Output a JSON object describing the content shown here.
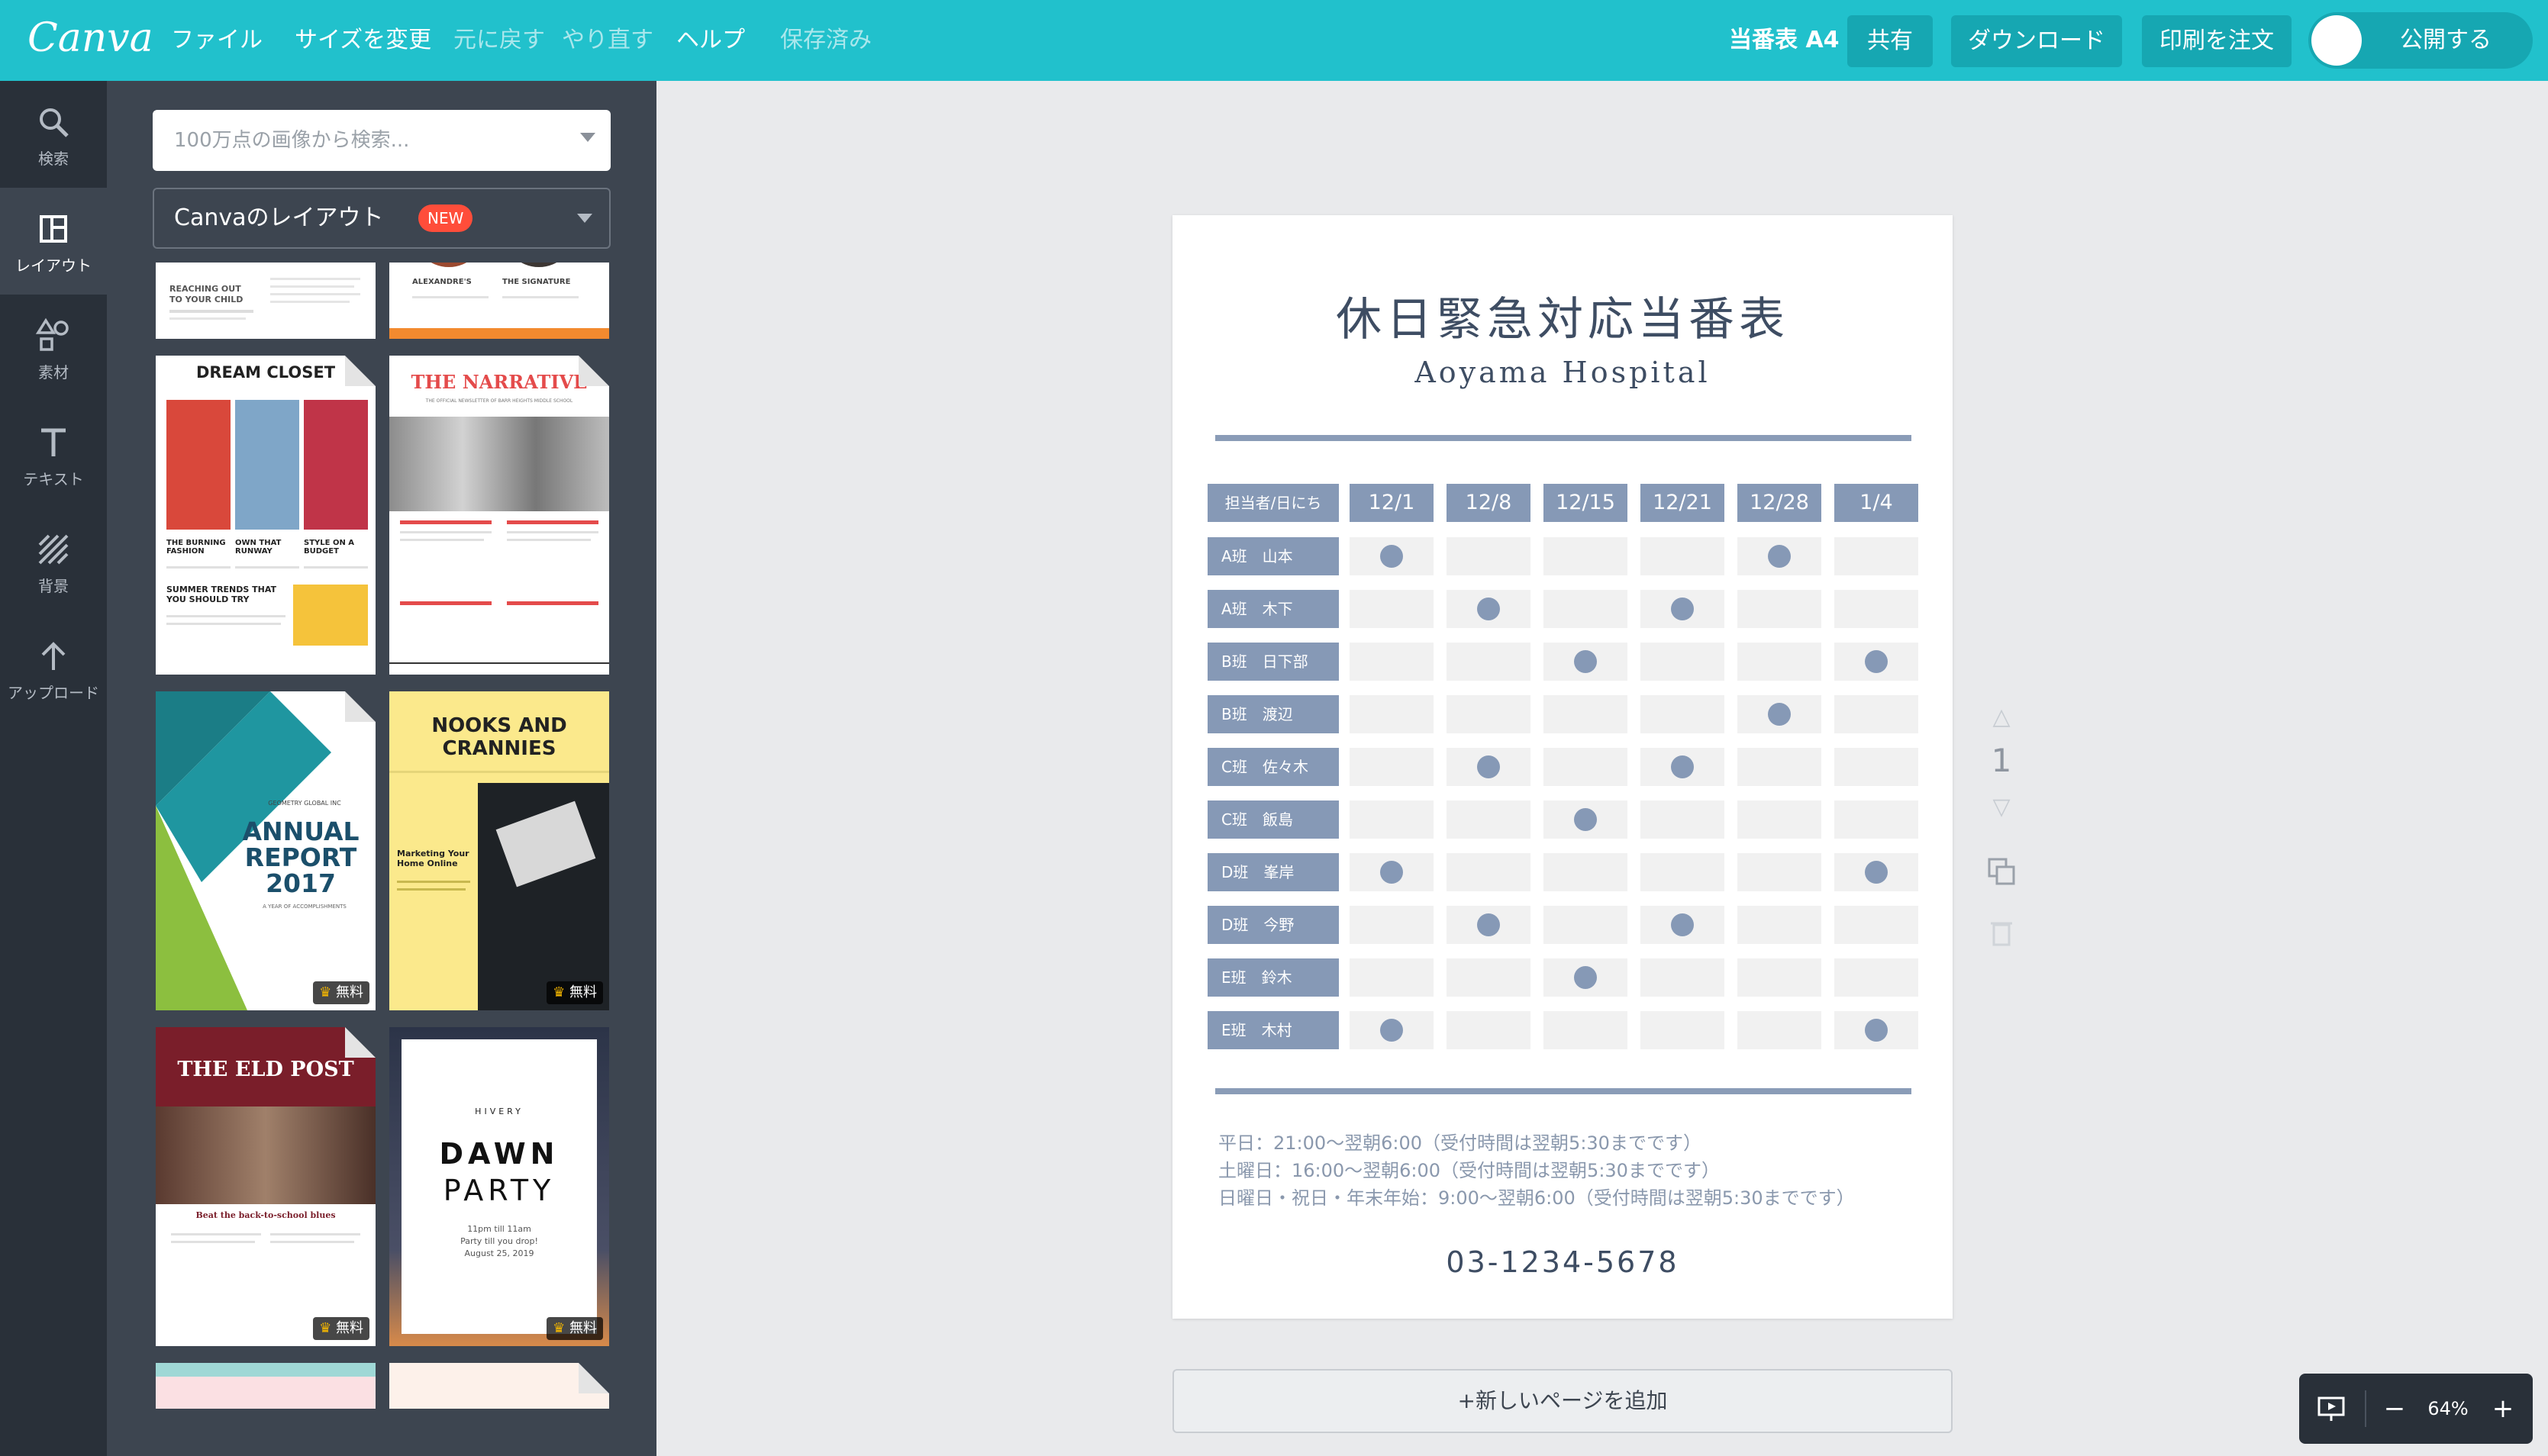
{
  "topbar": {
    "logo": "Canva",
    "menu": [
      "ファイル",
      "サイズを変更",
      "元に戻す",
      "やり直す",
      "ヘルプ",
      "保存済み"
    ],
    "doc_title": "当番表 A4",
    "share": "共有",
    "download": "ダウンロード",
    "order_print": "印刷を注文",
    "publish": "公開する",
    "accent_color": "#21c1cc"
  },
  "rail": [
    {
      "label": "検索",
      "icon": "search-icon"
    },
    {
      "label": "レイアウト",
      "icon": "layout-icon",
      "active": true
    },
    {
      "label": "素材",
      "icon": "elements-icon"
    },
    {
      "label": "テキスト",
      "icon": "text-icon"
    },
    {
      "label": "背景",
      "icon": "background-icon"
    },
    {
      "label": "アップロード",
      "icon": "upload-icon"
    }
  ],
  "panel": {
    "search_placeholder": "100万点の画像から検索...",
    "layout_select": "Canvaのレイアウト",
    "new_badge": "NEW",
    "free_label": "無料",
    "thumbs": {
      "t1": {
        "heading": "REACHING OUT TO YOUR CHILD"
      },
      "t2": {
        "heading_a": "ALEXANDRE'S",
        "heading_b": "THE SIGNATURE"
      },
      "t3": {
        "title": "DREAM CLOSET",
        "s1": "THE BURNING FASHION",
        "s2": "OWN THAT RUNWAY",
        "s3": "STYLE ON A BUDGET",
        "s4": "SUMMER TRENDS THAT YOU SHOULD TRY"
      },
      "t4": {
        "title": "THE NARRATIVE",
        "sub": "THE OFFICIAL NEWSLETTER OF BARR HEIGHTS MIDDLE SCHOOL"
      },
      "t5": {
        "org": "GEOMETRY GLOBAL INC",
        "title1": "ANNUAL",
        "title2": "REPORT",
        "year": "2017",
        "tag": "A YEAR OF ACCOMPLISHMENTS"
      },
      "t6": {
        "title": "NOOKS AND CRANNIES",
        "body": "Marketing Your Home Online"
      },
      "t7": {
        "title": "THE ELD POST",
        "sub": "Beat the back-to-school blues"
      },
      "t8": {
        "brand": "HIVERY",
        "title1": "DAWN",
        "title2": "PARTY",
        "line1": "11pm till 11am",
        "line2": "Party till you drop!",
        "date": "August 25, 2019"
      }
    }
  },
  "document": {
    "title": "休日緊急対応当番表",
    "subtitle": "Aoyama Hospital",
    "header_label": "担当者/日にち",
    "dates": [
      "12/1",
      "12/8",
      "12/15",
      "12/21",
      "12/28",
      "1/4"
    ],
    "rows": [
      {
        "name": "A班　山本",
        "duty": [
          true,
          false,
          false,
          false,
          true,
          false
        ]
      },
      {
        "name": "A班　木下",
        "duty": [
          false,
          true,
          false,
          true,
          false,
          false
        ]
      },
      {
        "name": "B班　日下部",
        "duty": [
          false,
          false,
          true,
          false,
          false,
          true
        ]
      },
      {
        "name": "B班　渡辺",
        "duty": [
          false,
          false,
          false,
          false,
          true,
          false
        ]
      },
      {
        "name": "C班　佐々木",
        "duty": [
          false,
          true,
          false,
          true,
          false,
          false
        ]
      },
      {
        "name": "C班　飯島",
        "duty": [
          false,
          false,
          true,
          false,
          false,
          false
        ]
      },
      {
        "name": "D班　峯岸",
        "duty": [
          true,
          false,
          false,
          false,
          false,
          true
        ]
      },
      {
        "name": "D班　今野",
        "duty": [
          false,
          true,
          false,
          true,
          false,
          false
        ]
      },
      {
        "name": "E班　鈴木",
        "duty": [
          false,
          false,
          true,
          false,
          false,
          false
        ]
      },
      {
        "name": "E班　木村",
        "duty": [
          true,
          false,
          false,
          false,
          false,
          true
        ]
      }
    ],
    "notes": [
      "平日：21:00〜翌朝6:00（受付時間は翌朝5:30までです）",
      "土曜日：16:00〜翌朝6:00（受付時間は翌朝5:30までです）",
      "日曜日・祝日・年末年始：9:00〜翌朝6:00（受付時間は翌朝5:30までです）"
    ],
    "phone": "03-1234-5678",
    "primary_color": "#8699b6"
  },
  "page_number": "1",
  "add_page": "+新しいページを追加",
  "zoom": {
    "level": "64%",
    "minus": "−",
    "plus": "+"
  }
}
